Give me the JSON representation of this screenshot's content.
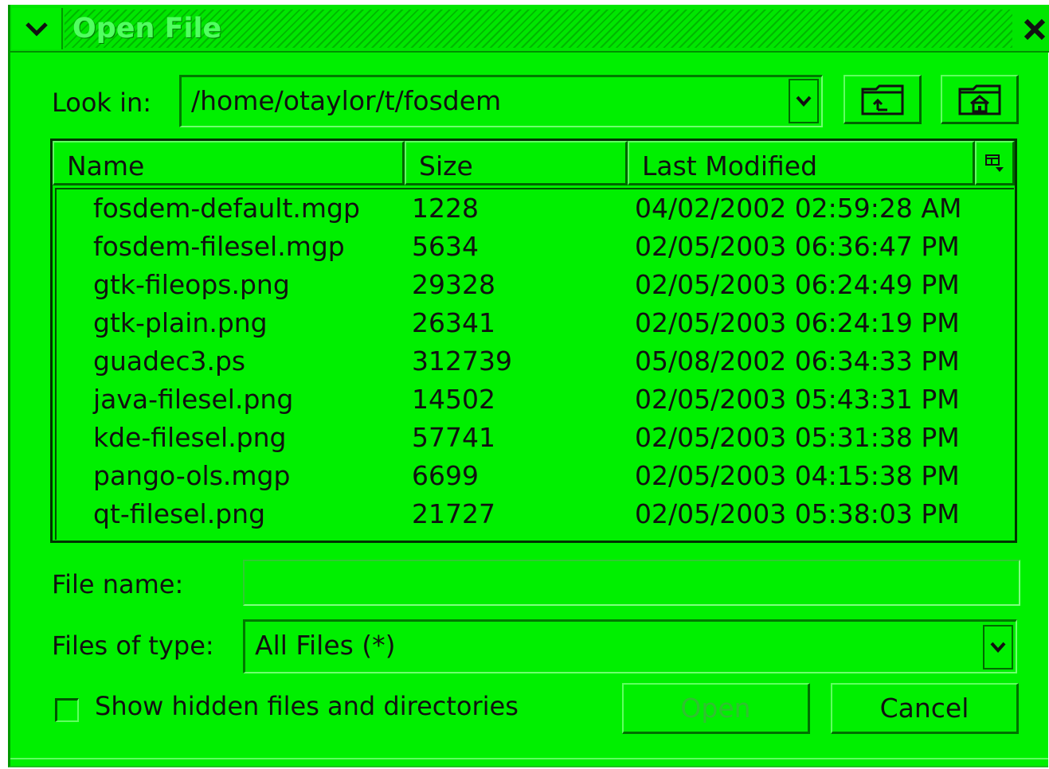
{
  "window": {
    "title": "Open File"
  },
  "look_in": {
    "label": "Look in:",
    "path": "/home/otaylor/t/fosdem"
  },
  "toolbar": {
    "up_icon": "folder-up-icon",
    "home_icon": "folder-home-icon"
  },
  "file_list": {
    "columns": [
      "Name",
      "Size",
      "Last Modified"
    ],
    "rows": [
      {
        "name": "fosdem-default.mgp",
        "size": "1228",
        "modified": "04/02/2002 02:59:28 AM"
      },
      {
        "name": "fosdem-filesel.mgp",
        "size": "5634",
        "modified": "02/05/2003 06:36:47 PM"
      },
      {
        "name": "gtk-fileops.png",
        "size": "29328",
        "modified": "02/05/2003 06:24:49 PM"
      },
      {
        "name": "gtk-plain.png",
        "size": "26341",
        "modified": "02/05/2003 06:24:19 PM"
      },
      {
        "name": "guadec3.ps",
        "size": "312739",
        "modified": "05/08/2002 06:34:33 PM"
      },
      {
        "name": "java-filesel.png",
        "size": "14502",
        "modified": "02/05/2003 05:43:31 PM"
      },
      {
        "name": "kde-filesel.png",
        "size": "57741",
        "modified": "02/05/2003 05:31:38 PM"
      },
      {
        "name": "pango-ols.mgp",
        "size": "6699",
        "modified": "02/05/2003 04:15:38 PM"
      },
      {
        "name": "qt-filesel.png",
        "size": "21727",
        "modified": "02/05/2003 05:38:03 PM"
      }
    ]
  },
  "file_name": {
    "label": "File name:",
    "value": ""
  },
  "file_type": {
    "label": "Files of type:",
    "value": "All Files (*)"
  },
  "options": {
    "show_hidden_label": "Show hidden files and directories",
    "show_hidden_checked": false
  },
  "buttons": {
    "open": "Open",
    "cancel": "Cancel"
  },
  "colors": {
    "background": "#00f000",
    "dark_border": "#007000",
    "light_border": "#60ff60"
  }
}
